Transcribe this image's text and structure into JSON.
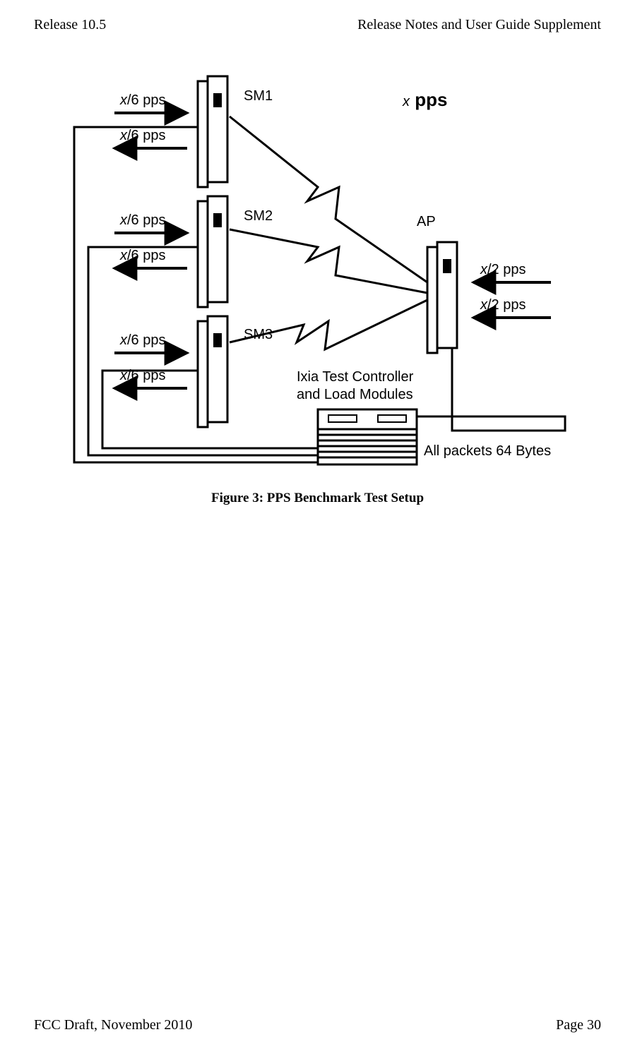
{
  "header": {
    "left": "Release 10.5",
    "right": "Release Notes and User Guide Supplement"
  },
  "footer": {
    "left": "FCC Draft, November 2010",
    "right": "Page 30"
  },
  "labels": {
    "sm1": "SM1",
    "sm2": "SM2",
    "sm3": "SM3",
    "ap": "AP",
    "x6": "/6 pps",
    "x2": "/2 pps",
    "xvar": "x",
    "pps_title_x": "x",
    "pps_title_rest": " pps",
    "ixia1": "Ixia  Test  Controller",
    "ixia2": "and  Load  Modules",
    "packets": "All packets 64 Bytes"
  },
  "caption": "Figure 3: PPS Benchmark Test Setup"
}
